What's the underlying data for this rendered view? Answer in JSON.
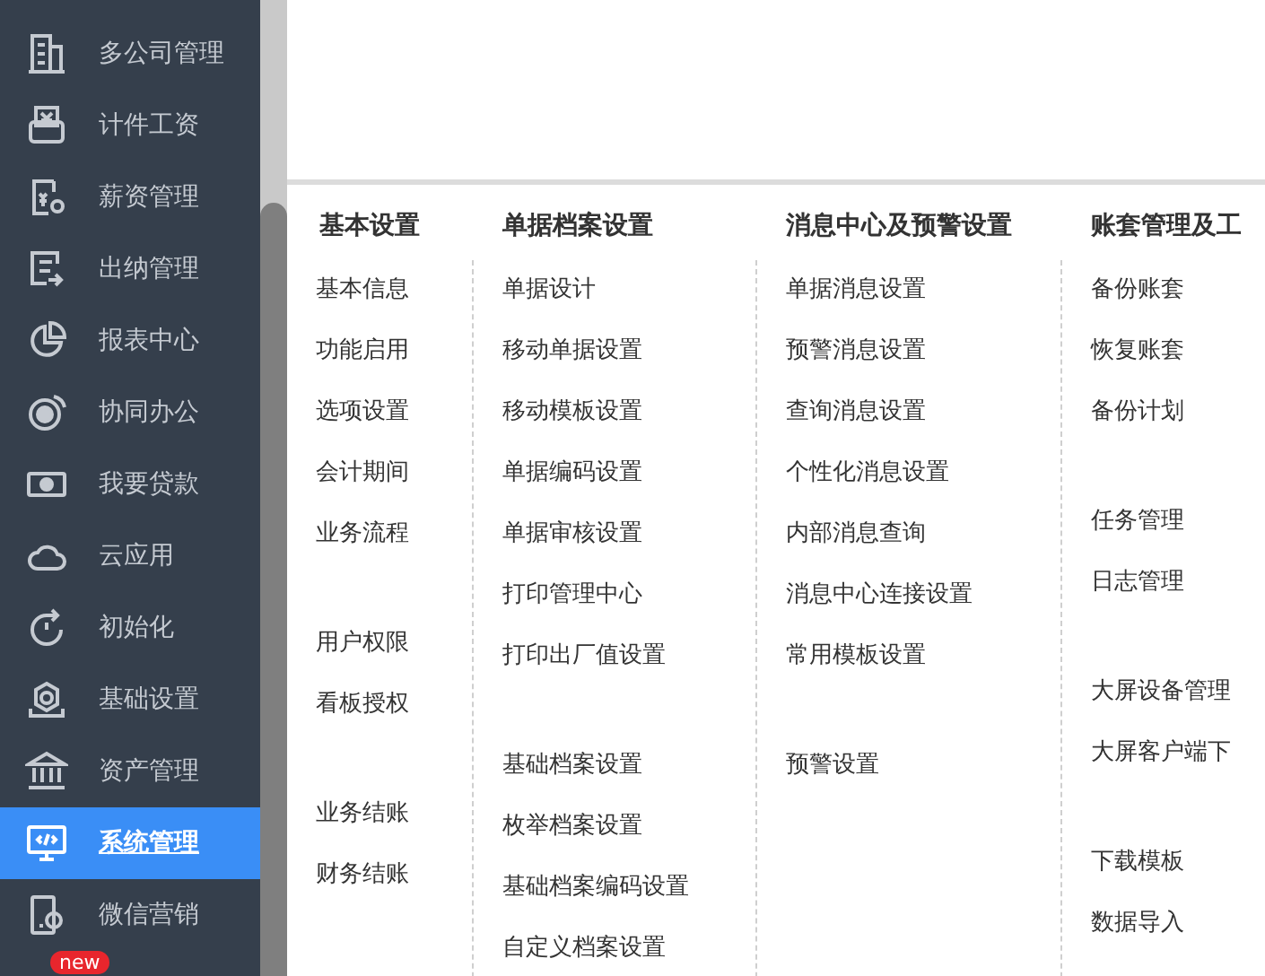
{
  "sidebar": {
    "items": [
      {
        "label": "多公司管理",
        "selected": false
      },
      {
        "label": "计件工资",
        "selected": false
      },
      {
        "label": "薪资管理",
        "selected": false
      },
      {
        "label": "出纳管理",
        "selected": false
      },
      {
        "label": "报表中心",
        "selected": false
      },
      {
        "label": "协同办公",
        "selected": false
      },
      {
        "label": "我要贷款",
        "selected": false
      },
      {
        "label": "云应用",
        "selected": false
      },
      {
        "label": "初始化",
        "selected": false
      },
      {
        "label": "基础设置",
        "selected": false
      },
      {
        "label": "资产管理",
        "selected": false
      },
      {
        "label": "系统管理",
        "selected": true
      },
      {
        "label": "微信营销",
        "selected": false,
        "badge": "new"
      }
    ]
  },
  "menu": {
    "columns": [
      {
        "title": "基本设置",
        "groups": [
          [
            "基本信息",
            "功能启用",
            "选项设置",
            "会计期间",
            "业务流程"
          ],
          [
            "用户权限",
            "看板授权"
          ],
          [
            "业务结账",
            "财务结账"
          ]
        ]
      },
      {
        "title": "单据档案设置",
        "groups": [
          [
            "单据设计",
            "移动单据设置",
            "移动模板设置",
            "单据编码设置",
            "单据审核设置",
            "打印管理中心",
            "打印出厂值设置"
          ],
          [
            "基础档案设置",
            "枚举档案设置",
            "基础档案编码设置",
            "自定义档案设置"
          ]
        ]
      },
      {
        "title": "消息中心及预警设置",
        "groups": [
          [
            "单据消息设置",
            "预警消息设置",
            "查询消息设置",
            "个性化消息设置",
            "内部消息查询",
            "消息中心连接设置",
            "常用模板设置"
          ],
          [
            "预警设置"
          ]
        ]
      },
      {
        "title": "账套管理及工",
        "groups": [
          [
            "备份账套",
            "恢复账套",
            "备份计划"
          ],
          [
            "任务管理",
            "日志管理"
          ],
          [
            "大屏设备管理",
            "大屏客户端下"
          ],
          [
            "下载模板",
            "数据导入"
          ]
        ]
      }
    ]
  }
}
